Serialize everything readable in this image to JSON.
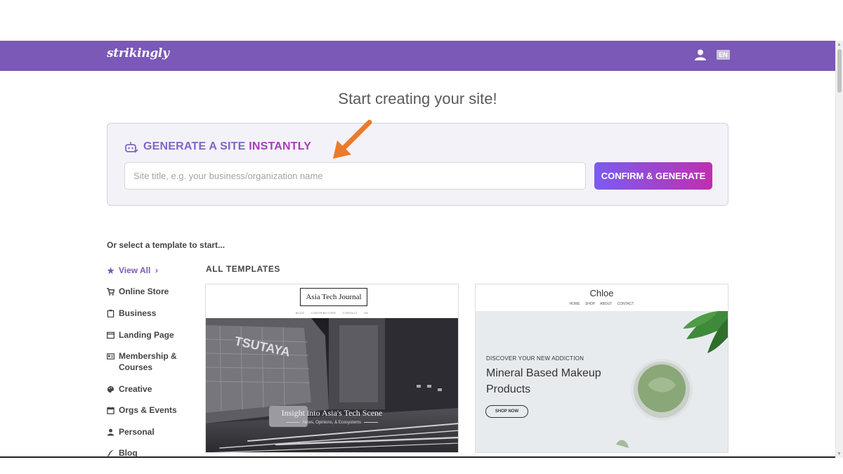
{
  "brand": {
    "logo_text": "strikingly",
    "primary_color": "#7b59b6"
  },
  "header": {
    "language": "EN",
    "user_icon": "user-icon"
  },
  "page": {
    "headline": "Start creating your site!"
  },
  "generator": {
    "icon": "robot-icon",
    "title_part1": "GENERATE A SITE ",
    "title_part2": "INSTANTLY",
    "input_placeholder": "Site title, e.g. your business/organization name",
    "input_value": "",
    "confirm_label": "CONFIRM & GENERATE"
  },
  "templates": {
    "intro": "Or select a template to start...",
    "section_title": "ALL TEMPLATES",
    "categories": [
      {
        "label": "View All",
        "icon": "star-icon",
        "suffix": "›"
      },
      {
        "label": "Online Store",
        "icon": "cart-icon"
      },
      {
        "label": "Business",
        "icon": "clipboard-icon"
      },
      {
        "label": "Landing Page",
        "icon": "window-icon"
      },
      {
        "label": "Membership & Courses",
        "icon": "id-card-icon"
      },
      {
        "label": "Creative",
        "icon": "palette-icon"
      },
      {
        "label": "Orgs & Events",
        "icon": "calendar-icon"
      },
      {
        "label": "Personal",
        "icon": "person-icon"
      },
      {
        "label": "Blog",
        "icon": "quill-icon"
      }
    ],
    "cards": [
      {
        "logo": "Asia Tech Journal",
        "nav": "BLOG CONTRIBUTORS CONTACT US",
        "tagline": "Insight into Asia's Tech Scene",
        "subtagline": "News, Opinions, & Ecosystems",
        "sign_text": "TSUTAYA"
      },
      {
        "title": "Chloe",
        "nav": "HOME SHOP ABOUT CONTACT",
        "kicker": "DISCOVER YOUR NEW ADDICTION",
        "headline": "Mineral Based Makeup Products",
        "cta": "SHOP NOW"
      }
    ]
  },
  "annotation": {
    "arrow_color": "#ec7a2c"
  }
}
